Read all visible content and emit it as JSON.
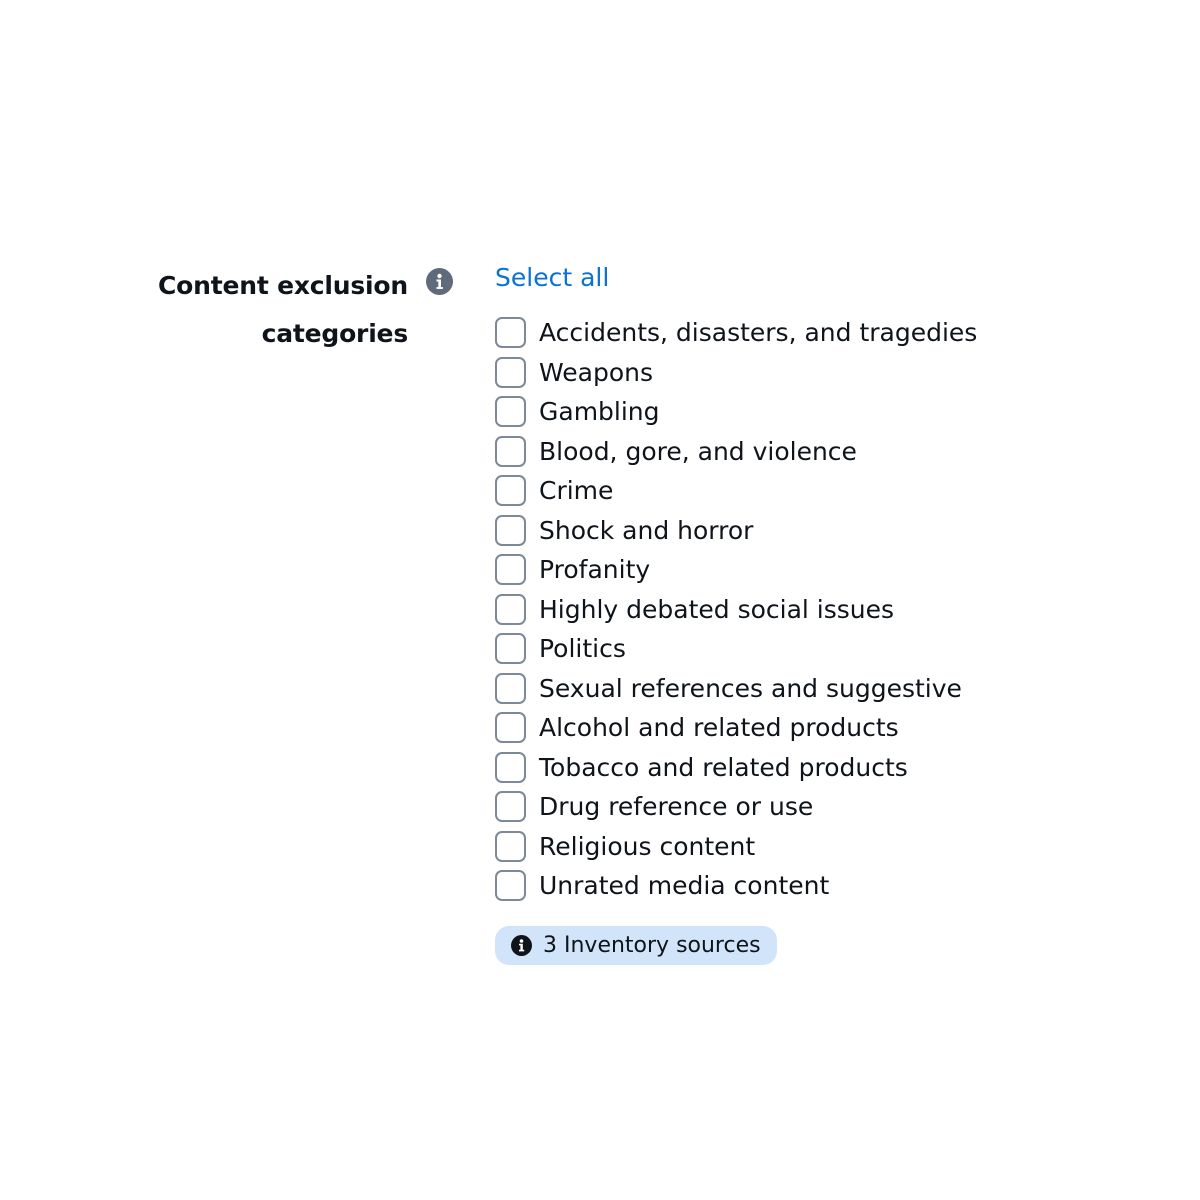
{
  "field": {
    "label_line1": "Content exclusion",
    "label_line2": "categories",
    "info_icon": "info-icon"
  },
  "select_all_label": "Select all",
  "options": [
    {
      "label": "Accidents, disasters, and tragedies",
      "checked": false
    },
    {
      "label": "Weapons",
      "checked": false
    },
    {
      "label": "Gambling",
      "checked": false
    },
    {
      "label": "Blood, gore, and violence",
      "checked": false
    },
    {
      "label": "Crime",
      "checked": false
    },
    {
      "label": "Shock and horror",
      "checked": false
    },
    {
      "label": "Profanity",
      "checked": false
    },
    {
      "label": "Highly debated social issues",
      "checked": false
    },
    {
      "label": "Politics",
      "checked": false
    },
    {
      "label": "Sexual references and suggestive",
      "checked": false
    },
    {
      "label": "Alcohol and related products",
      "checked": false
    },
    {
      "label": "Tobacco and related products",
      "checked": false
    },
    {
      "label": "Drug reference or use",
      "checked": false
    },
    {
      "label": "Religious content",
      "checked": false
    },
    {
      "label": "Unrated media content",
      "checked": false
    }
  ],
  "badge": {
    "icon": "info-icon",
    "text": "3 Inventory sources"
  },
  "colors": {
    "link": "#0972d3",
    "text": "#0f141a",
    "checkbox_border": "#7d8998",
    "icon_gray": "#5f6b7a",
    "badge_bg": "#d1e4fa"
  }
}
